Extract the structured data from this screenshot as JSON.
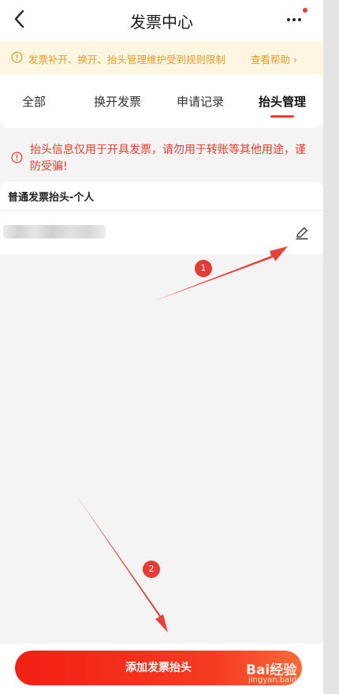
{
  "header": {
    "title": "发票中心"
  },
  "notice": {
    "text": "发票补开、换开、抬头管理维护受到规则限制",
    "link": "查看帮助 ›"
  },
  "tabs": [
    {
      "label": "全部",
      "active": false
    },
    {
      "label": "换开发票",
      "active": false
    },
    {
      "label": "申请记录",
      "active": false
    },
    {
      "label": "抬头管理",
      "active": true
    }
  ],
  "warning": {
    "text": "抬头信息仅用于开具发票，请勿用于转账等其他用途，谨防受骗!"
  },
  "invoice_title_section": {
    "heading": "普通发票抬头-个人"
  },
  "annotations": {
    "badge_1": "1",
    "badge_2": "2"
  },
  "bottom": {
    "add_button_label": "添加发票抬头"
  },
  "watermark": {
    "brand": "Bai经验",
    "url": "jingyan.baidu.com"
  },
  "colors": {
    "accent": "#f23b2f",
    "notice_text": "#e89a2a",
    "notice_bg": "#fdf6e0",
    "warning_text": "#ee3a2b"
  }
}
